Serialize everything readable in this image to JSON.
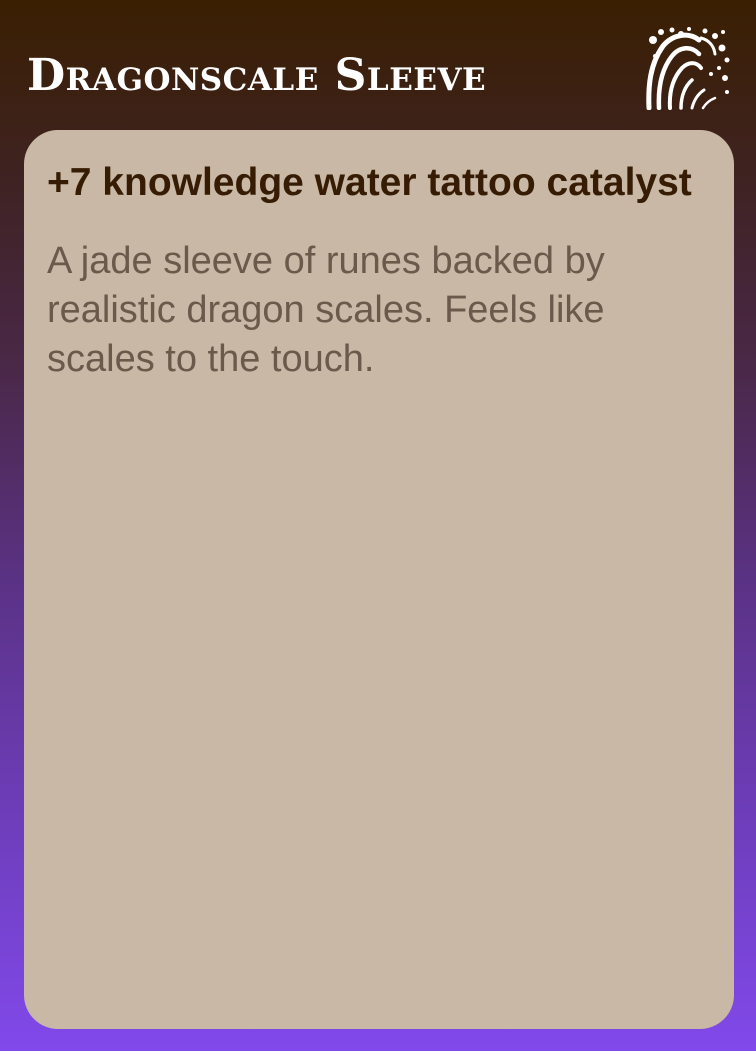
{
  "card": {
    "title": "Dragonscale Sleeve",
    "element_icon": "water-wave-icon",
    "stat_line": "+7 knowledge water tattoo catalyst",
    "description": "A jade sleeve of runes backed by realistic dragon scales. Feels like scales to the touch."
  },
  "colors": {
    "gradient_top": "#3a1f02",
    "gradient_bottom": "#8149ea",
    "panel": "#c9b8a5",
    "stat_text": "#361c04",
    "description_text": "#6b5a4c",
    "title_text": "#ffffff"
  }
}
